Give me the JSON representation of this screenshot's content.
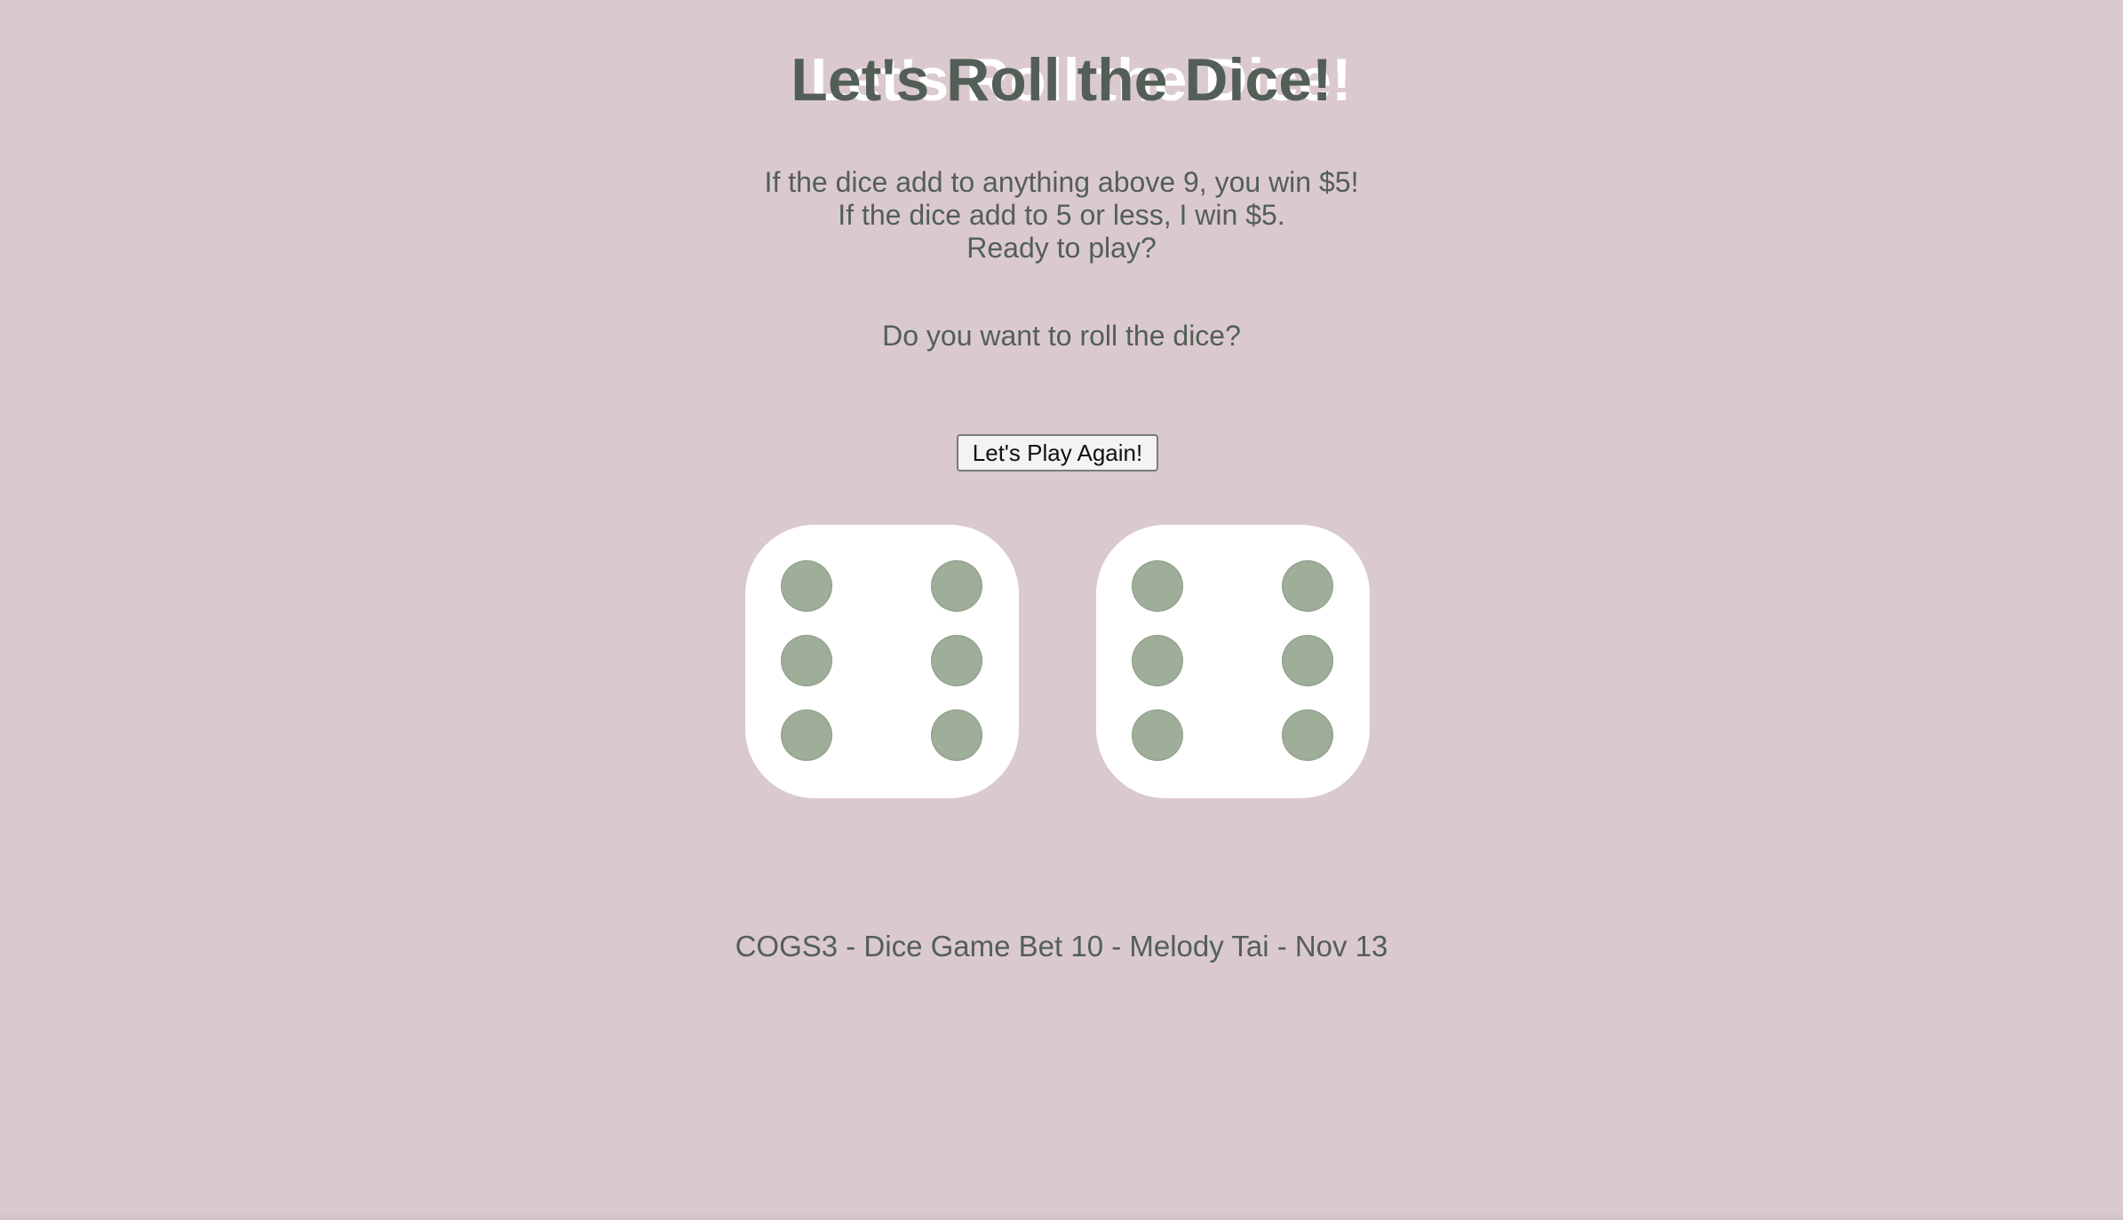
{
  "page": {
    "title": "Let's Roll the Dice!",
    "rules": [
      "If the dice add to anything above 9, you win $5!",
      "If the dice add to 5 or less, I win $5.",
      "Ready to play?"
    ],
    "question": "Do you want to roll the dice?",
    "play_button_label": "Let's Play Again!",
    "footer": "COGS3 - Dice Game Bet 10 - Melody Tai - Nov 13"
  },
  "dice": [
    {
      "value": 6
    },
    {
      "value": 6
    }
  ],
  "colors": {
    "background": "#dbc9d0",
    "text": "#535f56",
    "die_face": "#ffffff",
    "pip": "#9fae98"
  }
}
